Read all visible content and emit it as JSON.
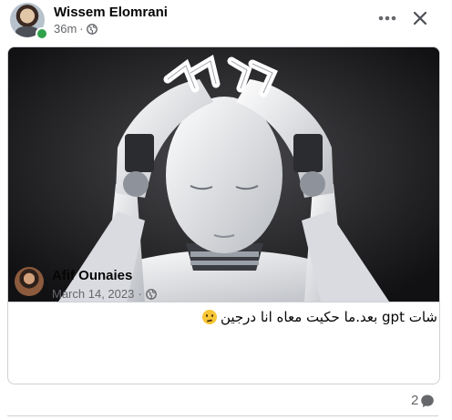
{
  "post": {
    "author_name": "Wissem Elomrani",
    "time": "36m",
    "separator": "·",
    "privacy_icon": "globe-icon",
    "online_status": "online",
    "actions": {
      "more_icon": "more-horizontal-icon",
      "close_icon": "close-icon"
    }
  },
  "shared_post": {
    "image_desc_icon": "robot-image",
    "author_name": "Afif Ounaies",
    "date": "March 14, 2023",
    "separator": "·",
    "privacy_icon": "globe-icon",
    "text": "شات gpt بعد.ما حكيت معاه انا درجين",
    "emoji": "confused-face-emoji"
  },
  "footer": {
    "comment_count": "2",
    "comment_icon": "comment-bubble-icon"
  },
  "colors": {
    "online": "#31a24c",
    "secondary_text": "#65676b",
    "border": "#ced0d4"
  }
}
